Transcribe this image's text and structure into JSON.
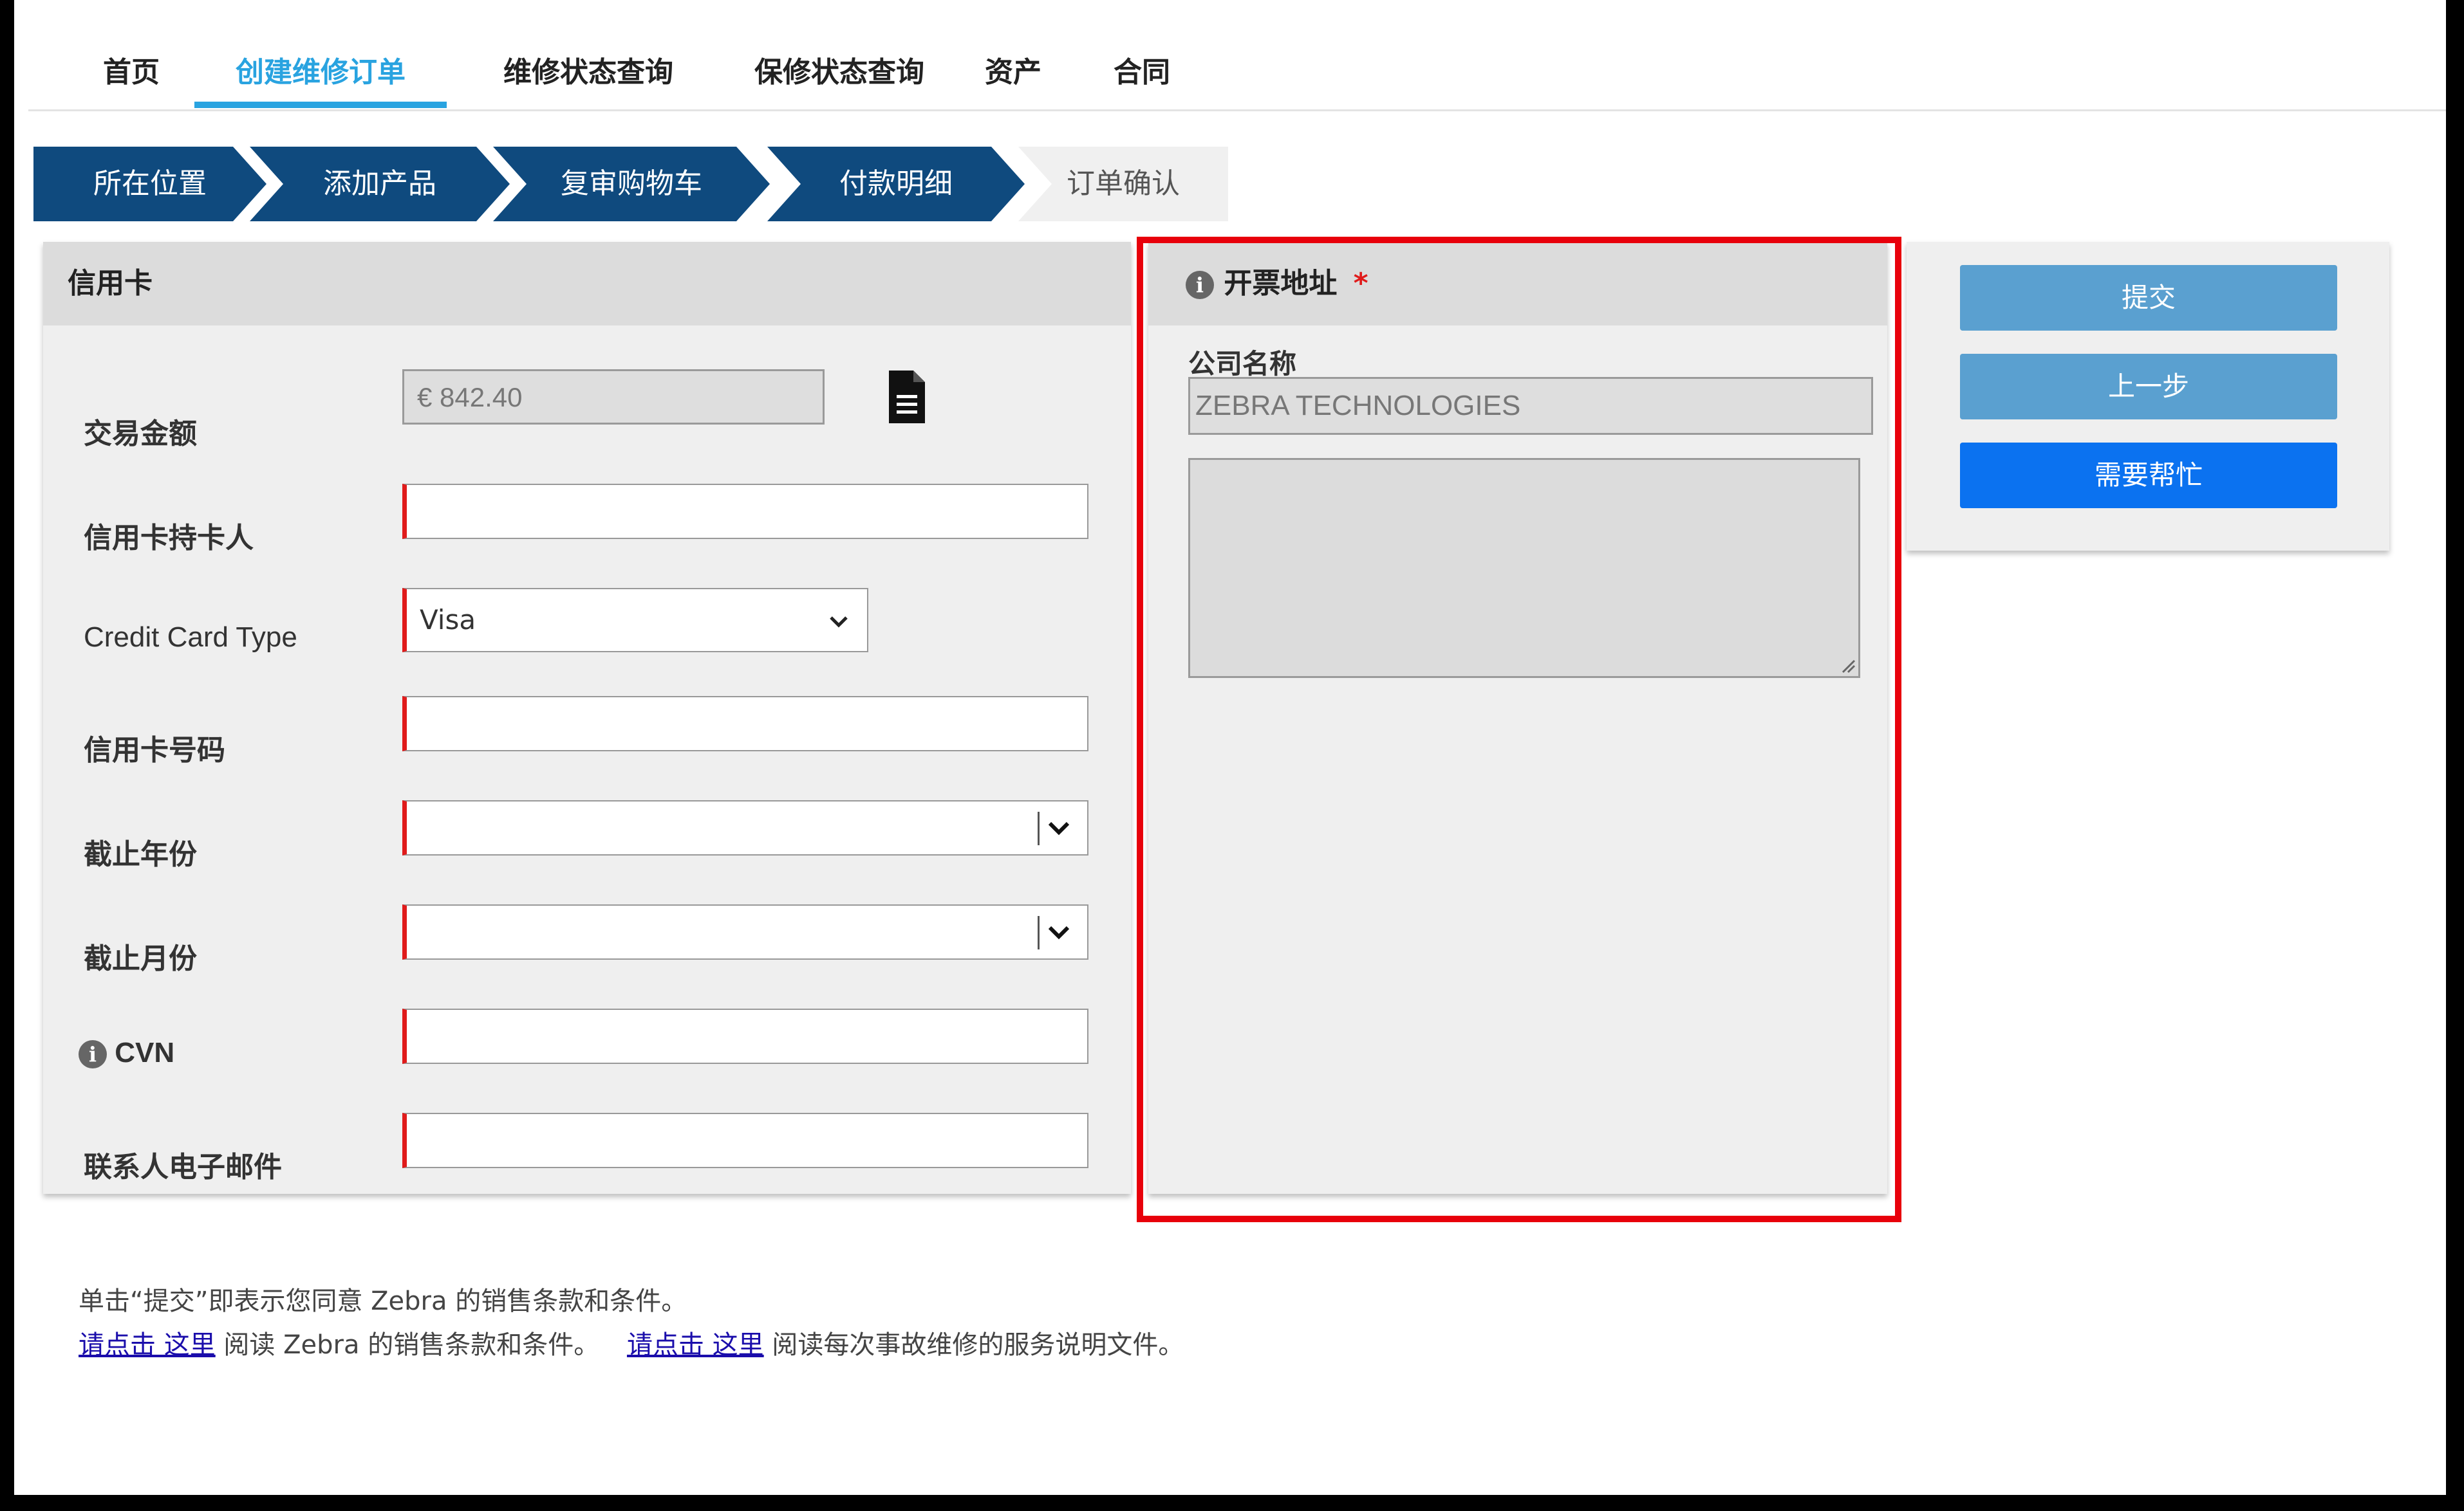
{
  "nav": {
    "items": [
      "首页",
      "创建维修订单",
      "维修状态查询",
      "保修状态查询",
      "资产",
      "合同"
    ],
    "active_index": 1
  },
  "breadcrumb": {
    "steps": [
      "所在位置",
      "添加产品",
      "复审购物车",
      "付款明细",
      "订单确认"
    ],
    "current_index": 3
  },
  "credit_card": {
    "title": "信用卡",
    "amount_label": "交易金额",
    "amount_value": "€ 842.40",
    "holder_label": "信用卡持卡人",
    "holder_value": "",
    "type_label": "Credit Card Type",
    "type_value": "Visa",
    "number_label": "信用卡号码",
    "number_value": "",
    "exp_year_label": "截止年份",
    "exp_year_value": "",
    "exp_month_label": "截止月份",
    "exp_month_value": "",
    "cvn_label": "CVN",
    "cvn_value": "",
    "email_label": "联系人电子邮件",
    "email_value": ""
  },
  "billing": {
    "title": "开票地址",
    "required_mark": "*",
    "company_label": "公司名称",
    "company_value": "ZEBRA TECHNOLOGIES",
    "address_value": ""
  },
  "actions": {
    "submit": "提交",
    "previous": "上一步",
    "help": "需要帮忙"
  },
  "footer": {
    "line1": "单击“提交”即表示您同意 Zebra 的销售条款和条件。",
    "link1": "请点击 这里",
    "text1": " 阅读 Zebra 的销售条款和条件。",
    "link2": "请点击 这里",
    "text2": " 阅读每次事故维修的服务说明文件。"
  },
  "colors": {
    "nav_active": "#29a3e0",
    "crumb_done": "#0f4a7e",
    "highlight": "#e8000b",
    "btn_secondary": "#5aa0d0",
    "btn_primary": "#0b72f0",
    "required": "#e01b1b"
  }
}
